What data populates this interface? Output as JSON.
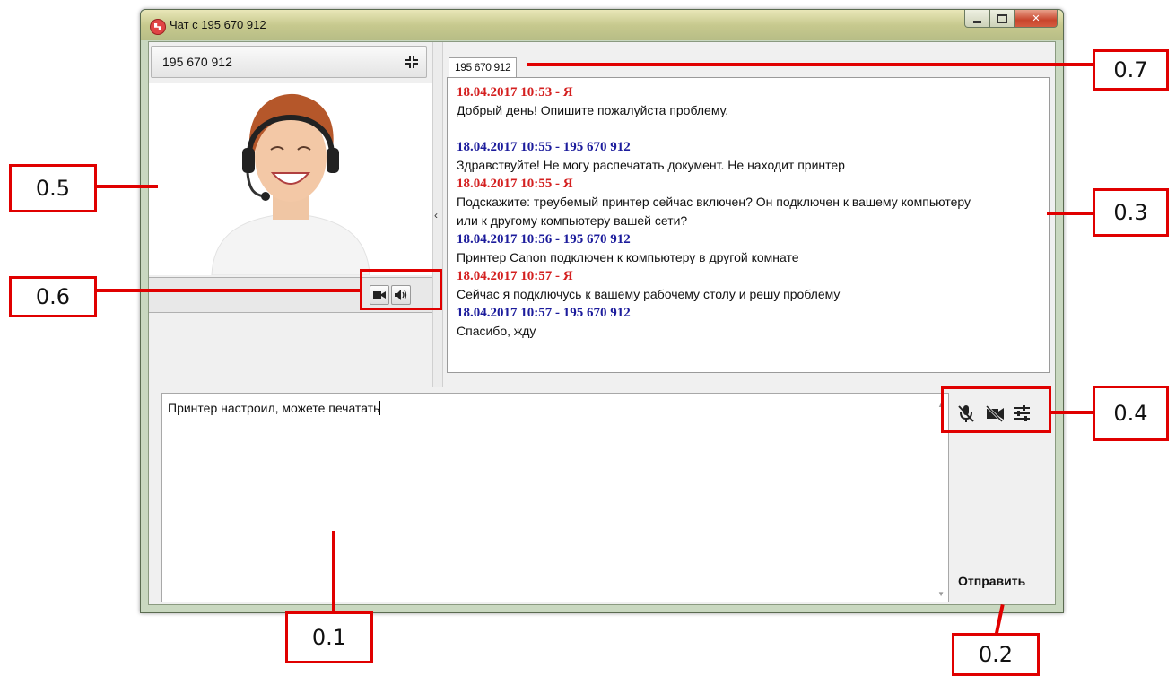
{
  "window": {
    "title": "Чат с 195 670 912"
  },
  "contact": {
    "name": "195 670 912"
  },
  "tab": {
    "label": "195 670 912"
  },
  "messages": [
    {
      "header": "18.04.2017 10:53 - Я",
      "sender": "me",
      "text": "Добрый день! Опишите пожалуйста проблему."
    },
    {
      "header": "18.04.2017 10:55 - 195 670 912",
      "sender": "them",
      "text": "Здравствуйте! Не могу распечатать документ. Не находит принтер"
    },
    {
      "header": "18.04.2017 10:55 - Я",
      "sender": "me",
      "text": "Подскажите: треубемый принтер сейчас включен? Он подключен к вашему компьютеру или к другому компьютеру вашей сети?"
    },
    {
      "header": "18.04.2017 10:56 - 195 670 912",
      "sender": "them",
      "text": "Принтер Canon подключен к компьютеру в другой комнате"
    },
    {
      "header": "18.04.2017 10:57 - Я",
      "sender": "me",
      "text": "Сейчас я подключусь к вашему рабочему столу и решу проблему"
    },
    {
      "header": "18.04.2017 10:57 - 195 670 912",
      "sender": "them",
      "text": "Спасибо, жду"
    }
  ],
  "input": {
    "value": "Принтер настроил, можете печатать"
  },
  "send_label": "Отправить",
  "annotations": {
    "a1": "0.1",
    "a2": "0.2",
    "a3": "0.3",
    "a4": "0.4",
    "a5": "0.5",
    "a6": "0.6",
    "a7": "0.7"
  },
  "colors": {
    "me": "#d42020",
    "them": "#1c1c9c",
    "annotation": "#e00000"
  },
  "icons": [
    "app-icon",
    "minimize-icon",
    "maximize-icon",
    "close-icon",
    "collapse-icon",
    "camera-icon",
    "speaker-icon",
    "mic-off-icon",
    "camera-off-icon",
    "settings-sliders-icon"
  ]
}
